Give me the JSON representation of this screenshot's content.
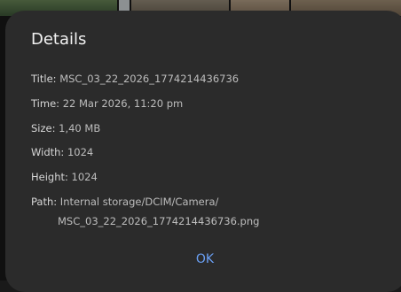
{
  "dialog": {
    "title": "Details",
    "fields": [
      {
        "label": "Title:",
        "value": "MSC_03_22_2026_1774214436736"
      },
      {
        "label": "Time:",
        "value": "22 Mar 2026, 11:20 pm"
      },
      {
        "label": "Size:",
        "value": "1,40 MB"
      },
      {
        "label": "Width:",
        "value": "1024"
      },
      {
        "label": "Height:",
        "value": "1024"
      },
      {
        "label": "Path:",
        "value": "Internal storage/DCIM/Camera/"
      }
    ],
    "path_continuation": "MSC_03_22_2026_1774214436736.png",
    "ok_label": "OK"
  },
  "colors": {
    "dialog_bg": "#2b2b2b",
    "accent": "#6aa0f5"
  }
}
